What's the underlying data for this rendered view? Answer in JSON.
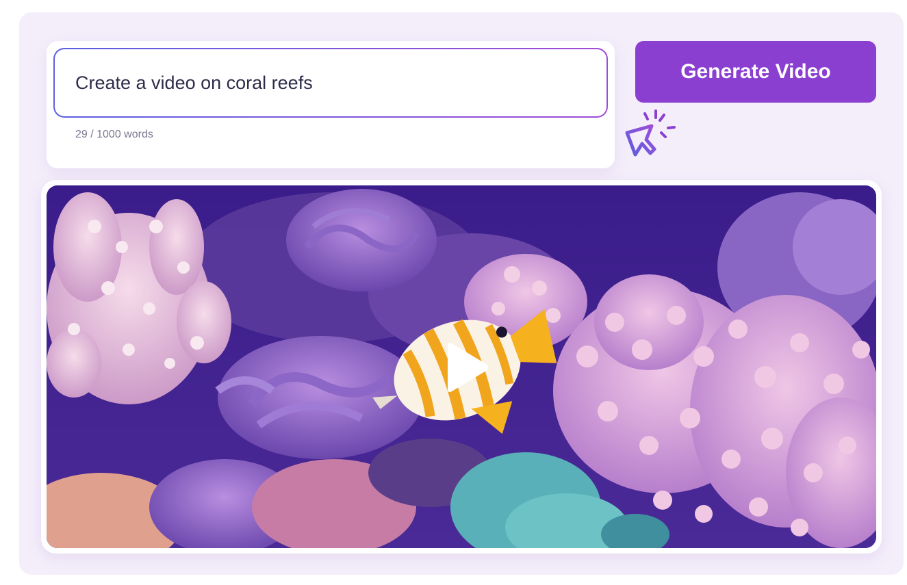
{
  "prompt": {
    "value": "Create a video on coral reefs",
    "word_count": "29 / 1000 words"
  },
  "actions": {
    "generate_label": "Generate Video"
  },
  "video": {
    "subject": "coral reef with butterflyfish",
    "play_icon": "play-icon"
  },
  "icons": {
    "cursor": "cursor-click-icon"
  },
  "colors": {
    "accent": "#8a3fd1",
    "input_border_start": "#5b5fe0",
    "input_border_end": "#a04cd6",
    "panel_bg": "#f4eefb"
  }
}
